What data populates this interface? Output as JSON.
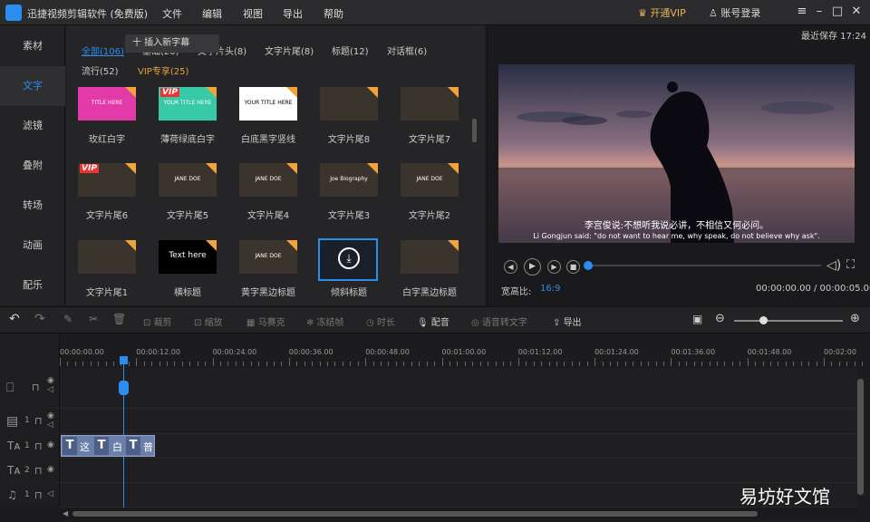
{
  "app": {
    "title": "迅捷视频剪辑软件 (免费版)",
    "menus": [
      "文件",
      "编辑",
      "视图",
      "导出",
      "帮助"
    ],
    "vip": "开通VIP",
    "login": "账号登录"
  },
  "left_tabs": [
    "素材",
    "文字",
    "滤镜",
    "叠附",
    "转场",
    "动画",
    "配乐"
  ],
  "categories": [
    "全部(106)",
    "基础(20)",
    "文字片头(8)",
    "文字片尾(8)",
    "标题(12)",
    "对话框(6)",
    "流行(52)",
    "VIP专享(25)"
  ],
  "insert_button": "十 插入新字幕",
  "templates": [
    {
      "label": "玫红白字",
      "thumb_text": "TITLE HERE",
      "bg": "#e23aa8"
    },
    {
      "label": "薄荷绿底白字",
      "thumb_text": "YOUR TITLE HERE",
      "bg": "#38c9a8",
      "vip": "VIP"
    },
    {
      "label": "白底黑字竖线",
      "thumb_text": "YOUR TITLE HERE",
      "bg": "#ffffff"
    },
    {
      "label": "文字片尾8",
      "thumb_text": "",
      "bg": "#3a342c"
    },
    {
      "label": "文字片尾7",
      "thumb_text": "",
      "bg": "#3a342c"
    },
    {
      "label": "文字片尾6",
      "thumb_text": "",
      "bg": "#3a342c",
      "vip": "VIP"
    },
    {
      "label": "文字片尾5",
      "thumb_text": "JANE DOE",
      "bg": "#3a342c"
    },
    {
      "label": "文字片尾4",
      "thumb_text": "JANE DOE",
      "bg": "#3a342c"
    },
    {
      "label": "文字片尾3",
      "thumb_text": "Joe Biography",
      "bg": "#3a342c"
    },
    {
      "label": "文字片尾2",
      "thumb_text": "JANE DOE",
      "bg": "#3a342c"
    },
    {
      "label": "文字片尾1",
      "thumb_text": "",
      "bg": "#3a342c"
    },
    {
      "label": "横标题",
      "thumb_text": "Text here",
      "bg": "#000000"
    },
    {
      "label": "黄字黑边标题",
      "thumb_text": "JANE DOE",
      "bg": "#3a342c"
    },
    {
      "label": "倾斜标题",
      "thumb_text": "",
      "bg": "#1a1f2a",
      "selected": true
    },
    {
      "label": "白字黑边标题",
      "thumb_text": "",
      "bg": "#3a342c"
    }
  ],
  "preview": {
    "save_time": "最近保存 17:24",
    "subtitle_cn": "李宫俊说:不想听我说必讲，不相信又何必问。",
    "subtitle_en": "Li Gongjun said: \"do not want to hear me, why speak, do not believe why ask\".",
    "ratio_label": "宽高比:",
    "ratio_value": "16:9",
    "timecode": "00:00:00.00 / 00:00:05.00",
    "progress": 0
  },
  "toolbar": [
    "裁剪",
    "缩放",
    "马赛克",
    "冻结帧",
    "时长",
    "配音",
    "语音转文字",
    "导出"
  ],
  "ruler_ticks": [
    "00:00:00.00",
    "00:00:12.00",
    "00:00:24.00",
    "00:00:36.00",
    "00:00:48.00",
    "00:01:00.00",
    "00:01:12.00",
    "00:01:24.00",
    "00:01:36.00",
    "00:01:48.00",
    "00:02:00"
  ],
  "track_nums": [
    "1",
    "1",
    "2",
    "1"
  ],
  "clip_chars": [
    "这",
    "白",
    "普"
  ],
  "watermark": "易坊好文馆",
  "colors": {
    "accent": "#2d8cf0",
    "vip": "#e8b45a",
    "clip": "#6b7fa8"
  }
}
